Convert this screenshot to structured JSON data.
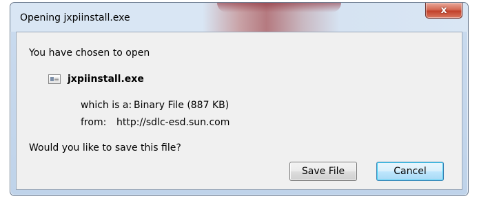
{
  "window": {
    "title": "Opening jxpiinstall.exe",
    "close_glyph": "x"
  },
  "dialog": {
    "heading": "You have chosen to open",
    "file": {
      "icon": "file-icon",
      "name": "jxpiinstall.exe"
    },
    "type_label": "which is a:",
    "type_value": "Binary File (887 KB)",
    "from_label": "from:",
    "from_value": "http://sdlc-esd.sun.com",
    "question": "Would you like to save this file?"
  },
  "buttons": {
    "save_label": "Save File",
    "cancel_label": "Cancel"
  },
  "colors": {
    "close_button": "#c2412b",
    "focused_button_border": "#3c7fb1",
    "content_background": "#f0f0f0"
  }
}
